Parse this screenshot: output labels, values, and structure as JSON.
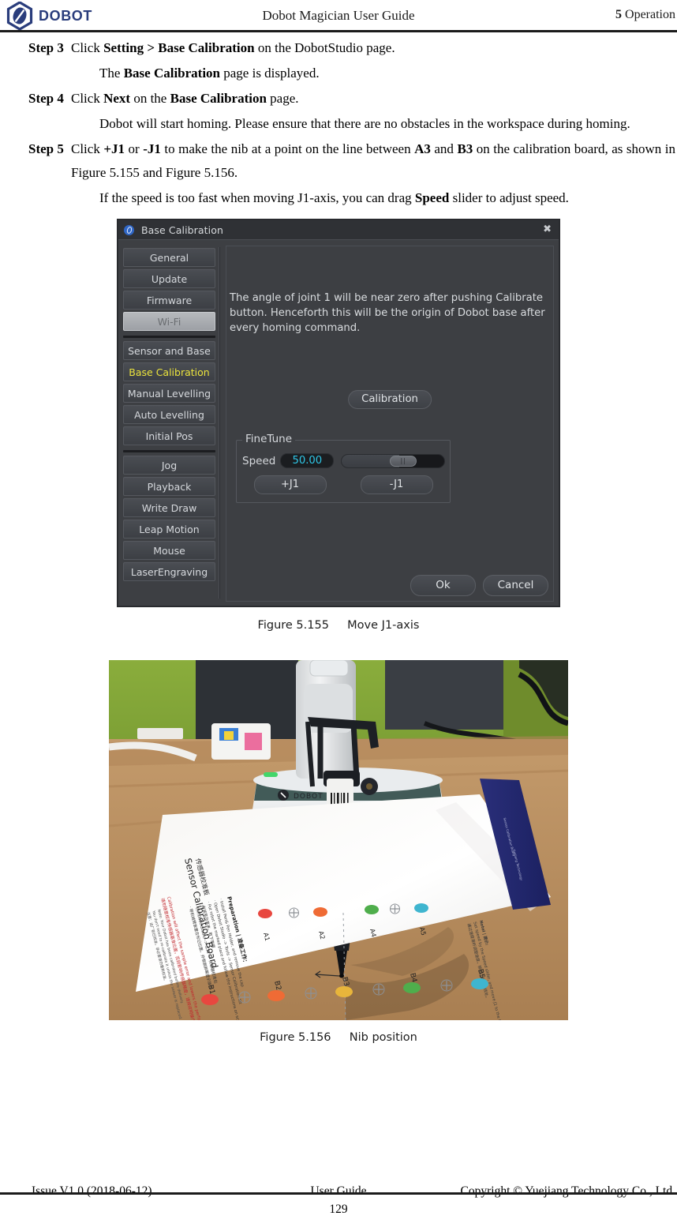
{
  "header": {
    "logo_text": "DOBOT",
    "logo_icon": "dobot-hexagon-logo",
    "title": "Dobot Magician User Guide",
    "chapter_number": "5",
    "chapter_name": "Operation",
    "brand_color": "#2a3d7c"
  },
  "steps": [
    {
      "label": "Step 3",
      "segments": [
        {
          "t": "Click ",
          "b": false
        },
        {
          "t": "Setting > Base Calibration",
          "b": true
        },
        {
          "t": " on the DobotStudio page.",
          "b": false
        }
      ]
    },
    {
      "label": "Step 4",
      "segments": [
        {
          "t": "Click ",
          "b": false
        },
        {
          "t": "Next",
          "b": true
        },
        {
          "t": " on the ",
          "b": false
        },
        {
          "t": "Base Calibration",
          "b": true
        },
        {
          "t": " page.",
          "b": false
        }
      ]
    },
    {
      "label": "Step 5",
      "segments": [
        {
          "t": "Click ",
          "b": false
        },
        {
          "t": "+J1",
          "b": true
        },
        {
          "t": " or ",
          "b": false
        },
        {
          "t": "-J1",
          "b": true
        },
        {
          "t": " to make the nib at a point on the line between ",
          "b": false
        },
        {
          "t": "A3",
          "b": true
        },
        {
          "t": " and ",
          "b": false
        },
        {
          "t": "B3",
          "b": true
        },
        {
          "t": " on the calibration board, as shown in Figure 5.155 and Figure 5.156.",
          "b": false
        }
      ]
    }
  ],
  "paragraphs": {
    "after_step3": [
      {
        "t": "The ",
        "b": false
      },
      {
        "t": "Base Calibration",
        "b": true
      },
      {
        "t": " page is displayed.",
        "b": false
      }
    ],
    "after_step4": [
      {
        "t": "Dobot will start homing. Please ensure that there are no obstacles in the workspace during homing.",
        "b": false
      }
    ],
    "after_step5": [
      {
        "t": "If the speed is too fast when moving J1-axis, you can drag ",
        "b": false
      },
      {
        "t": "Speed",
        "b": true
      },
      {
        "t": " slider to adjust speed.",
        "b": false
      }
    ]
  },
  "dialog": {
    "title": "Base Calibration",
    "title_icon": "dobot-app-icon",
    "close_label": "✖",
    "sidebar": {
      "group1": [
        {
          "label": "General",
          "state": "normal"
        },
        {
          "label": "Update",
          "state": "normal"
        },
        {
          "label": "Firmware",
          "state": "normal"
        },
        {
          "label": "Wi-Fi",
          "state": "disabled"
        }
      ],
      "group2": [
        {
          "label": "Sensor and Base",
          "state": "normal"
        },
        {
          "label": "Base Calibration",
          "state": "active"
        },
        {
          "label": "Manual Levelling",
          "state": "normal"
        },
        {
          "label": "Auto Levelling",
          "state": "normal"
        },
        {
          "label": "Initial Pos",
          "state": "normal"
        }
      ],
      "group3": [
        {
          "label": "Jog",
          "state": "normal"
        },
        {
          "label": "Playback",
          "state": "normal"
        },
        {
          "label": "Write  Draw",
          "state": "normal"
        },
        {
          "label": "Leap Motion",
          "state": "normal"
        },
        {
          "label": "Mouse",
          "state": "normal"
        },
        {
          "label": "LaserEngraving",
          "state": "normal"
        }
      ],
      "active_text_color": "#ebe33c"
    },
    "description": "The angle of joint 1 will be near zero after pushing Calibrate button. Henceforth this will be the origin of Dobot base after every homing command.",
    "calibration_button": "Calibration",
    "finetune": {
      "legend": "FineTune",
      "speed_label": "Speed",
      "speed_value": "50.00",
      "speed_value_color": "#2ec7e8",
      "slider_percent": 50,
      "plus_button": "+J1",
      "minus_button": "-J1"
    },
    "ok_button": "Ok",
    "cancel_button": "Cancel"
  },
  "figures": [
    {
      "number": "Figure 5.155",
      "caption": "Move J1-axis"
    },
    {
      "number": "Figure 5.156",
      "caption": "Nib position"
    }
  ],
  "photo": {
    "board_title": "Sensor Calibration Board",
    "device_label": "DOBOT",
    "prep_heading": "Preparation",
    "dots_row_a": [
      {
        "label": "A1",
        "color": "#e8473f"
      },
      {
        "label": "A2",
        "color": "#ef6b35"
      },
      {
        "label": "A4",
        "color": "#4fae4c"
      },
      {
        "label": "A5",
        "color": "#3fb5cf"
      }
    ],
    "dots_row_b": [
      {
        "label": "B1",
        "color": "#e8473f"
      },
      {
        "label": "B2",
        "color": "#ef6b35"
      },
      {
        "label": "B3",
        "color": "#e8b53b"
      },
      {
        "label": "B4",
        "color": "#4fae4c"
      },
      {
        "label": "B5",
        "color": "#3fb5cf"
      }
    ]
  },
  "footer": {
    "issue": "Issue V1.0 (2018-06-12)",
    "center": "User Guide",
    "copyright": "Copyright © Yuejiang Technology Co., Ltd.",
    "page_number": "129"
  }
}
